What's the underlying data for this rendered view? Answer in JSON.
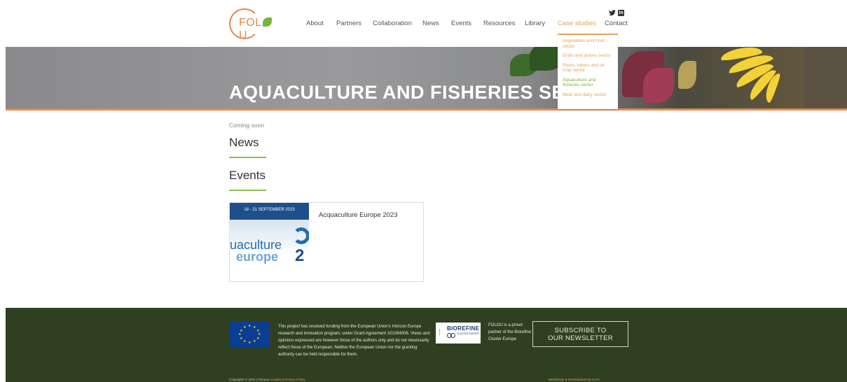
{
  "logo": {
    "text_before": "FOL",
    "text_after": "U"
  },
  "nav": {
    "items": [
      {
        "label": "About"
      },
      {
        "label": "Partners"
      },
      {
        "label": "Collaboration"
      },
      {
        "label": "News"
      },
      {
        "label": "Events"
      },
      {
        "label": "Resources"
      },
      {
        "label": "Library"
      },
      {
        "label": "Case studies"
      },
      {
        "label": "Contact"
      }
    ],
    "active": "Case studies",
    "accent_color": "#e8a15a"
  },
  "social": {
    "icons": [
      "twitter-icon",
      "linkedin-icon"
    ],
    "linkedin_glyph": "in",
    "twitter_glyph": "🐦"
  },
  "dropdown": {
    "items": [
      {
        "label": "Vegetables and Fruit sector"
      },
      {
        "label": "Grain and pulses sector"
      },
      {
        "label": "Roots, tubers and oil crop sector"
      },
      {
        "label": "Aquaculture and fisheries sector"
      },
      {
        "label": "Meat and dairy sector"
      }
    ]
  },
  "hero": {
    "title": "AQUACULTURE AND FISHERIES SE"
  },
  "main": {
    "coming_soon": "Coming soon",
    "news_title": "News",
    "events_title": "Events",
    "event": {
      "date": "18 - 21 SEPTEMBER 2023",
      "title": "Acquaculture Europe 2023",
      "thumb_word1": "uaculture",
      "thumb_word2": "europe",
      "thumb_num": "2"
    }
  },
  "footer": {
    "funding_text": "This project has received funding from the European Union's Horizon Europe research and innovation program, under Grant Agreement 101084006. Views and opinions expressed are however those of the authors only and do not necessarily reflect those of the European. Neither the European Union nor the granting authority can be held responsible for them.",
    "biorefine_main": "BIOREFINE",
    "biorefine_sub": "CLUSTER EUROPE",
    "partner_text": "FOLOU is a proud partner of the Biorefine Cluster Europe",
    "subscribe_line1": "SUBSCRIBE TO",
    "subscribe_line2": "OUR NEWSLETTER",
    "copyright_text": "Copyrights © 2023 | Folouau",
    "copyright_link": "Cookies & Privacy Policy",
    "webdesign": "Webdesign & Development by ALYS",
    "bg_color": "#2f4021"
  }
}
